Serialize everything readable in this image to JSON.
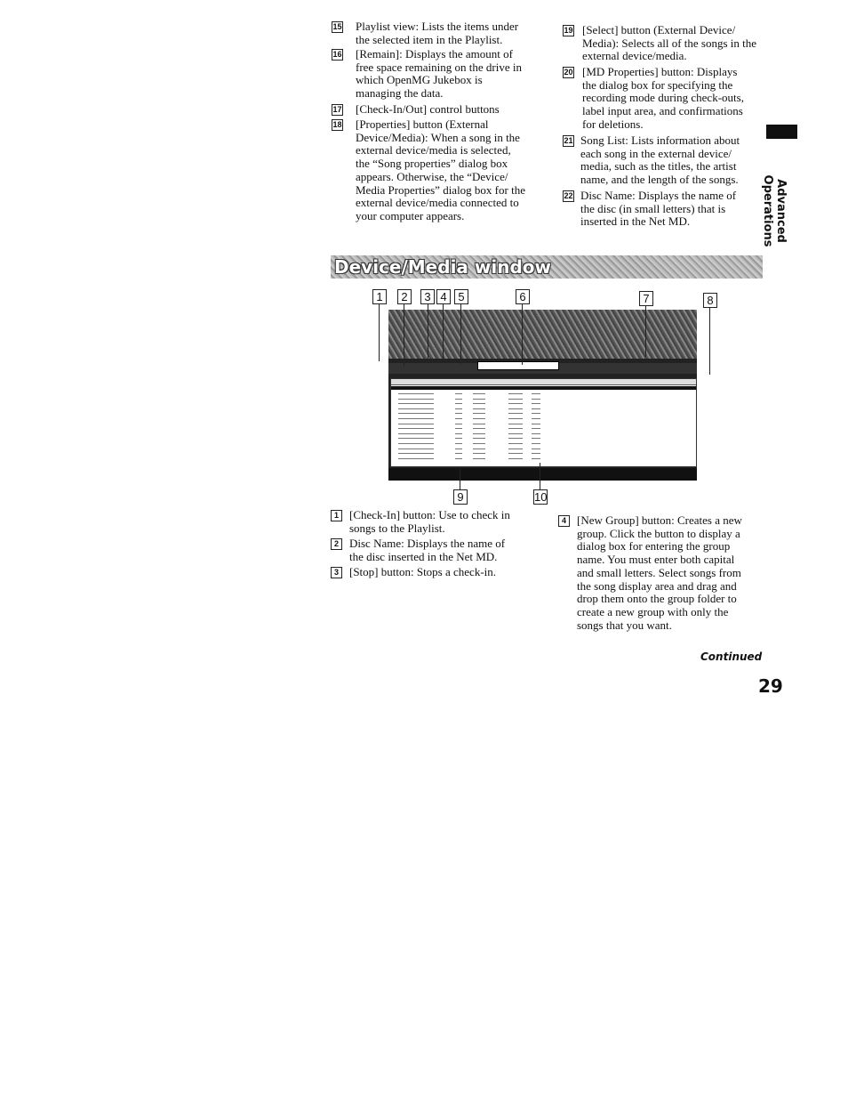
{
  "top_left_items": [
    {
      "num": "15",
      "text": "Playlist view: Lists the items under\nthe selected item in the Playlist."
    },
    {
      "num": "16",
      "text": "[Remain]: Displays the amount of\nfree space remaining on the drive in\nwhich OpenMG Jukebox is\nmanaging the data."
    },
    {
      "num": "17",
      "text": "[Check-In/Out] control buttons"
    },
    {
      "num": "18",
      "text": "[Properties] button (External\nDevice/Media): When a song in the\nexternal device/media is selected,\nthe “Song properties” dialog box\nappears. Otherwise, the “Device/\nMedia Properties” dialog box for the\nexternal device/media connected to\nyour computer appears."
    }
  ],
  "top_right_items": [
    {
      "num": "19",
      "text": "[Select] button (External Device/\nMedia): Selects all of the songs in the\nexternal device/media."
    },
    {
      "num": "20",
      "text": "[MD Properties] button: Displays\nthe dialog box for specifying the\nrecording mode during check-outs,\nlabel input area, and confirmations\nfor deletions."
    },
    {
      "num": "21",
      "text": "Song List: Lists information about\neach song in the external device/\nmedia, such as the titles, the artist\nname, and the length of the songs."
    },
    {
      "num": "22",
      "text": "Disc Name: Displays the name of\nthe disc (in small letters) that is\ninserted in the Net MD."
    }
  ],
  "section_title": "Device/Media window",
  "callouts": [
    "1",
    "2",
    "3",
    "4",
    "5",
    "6",
    "7",
    "8",
    "9",
    "10"
  ],
  "bottom_left_items": [
    {
      "num": "1",
      "text": "[Check-In] button: Use to check in\nsongs to the Playlist."
    },
    {
      "num": "2",
      "text": "Disc Name: Displays the name of\nthe disc inserted in the Net MD."
    },
    {
      "num": "3",
      "text": "[Stop] button: Stops a check-in."
    }
  ],
  "bottom_right_items": [
    {
      "num": "4",
      "text": "[New Group] button: Creates a new\ngroup. Click the button to display a\ndialog box for entering the group\nname. You must enter both capital\nand small letters. Select songs from\nthe song display area and drag and\ndrop them onto the group folder to\ncreate a new group with only the\nsongs that you want."
    }
  ],
  "side_tab": "Advanced Operations",
  "continued": "Continued",
  "page_number": "29"
}
